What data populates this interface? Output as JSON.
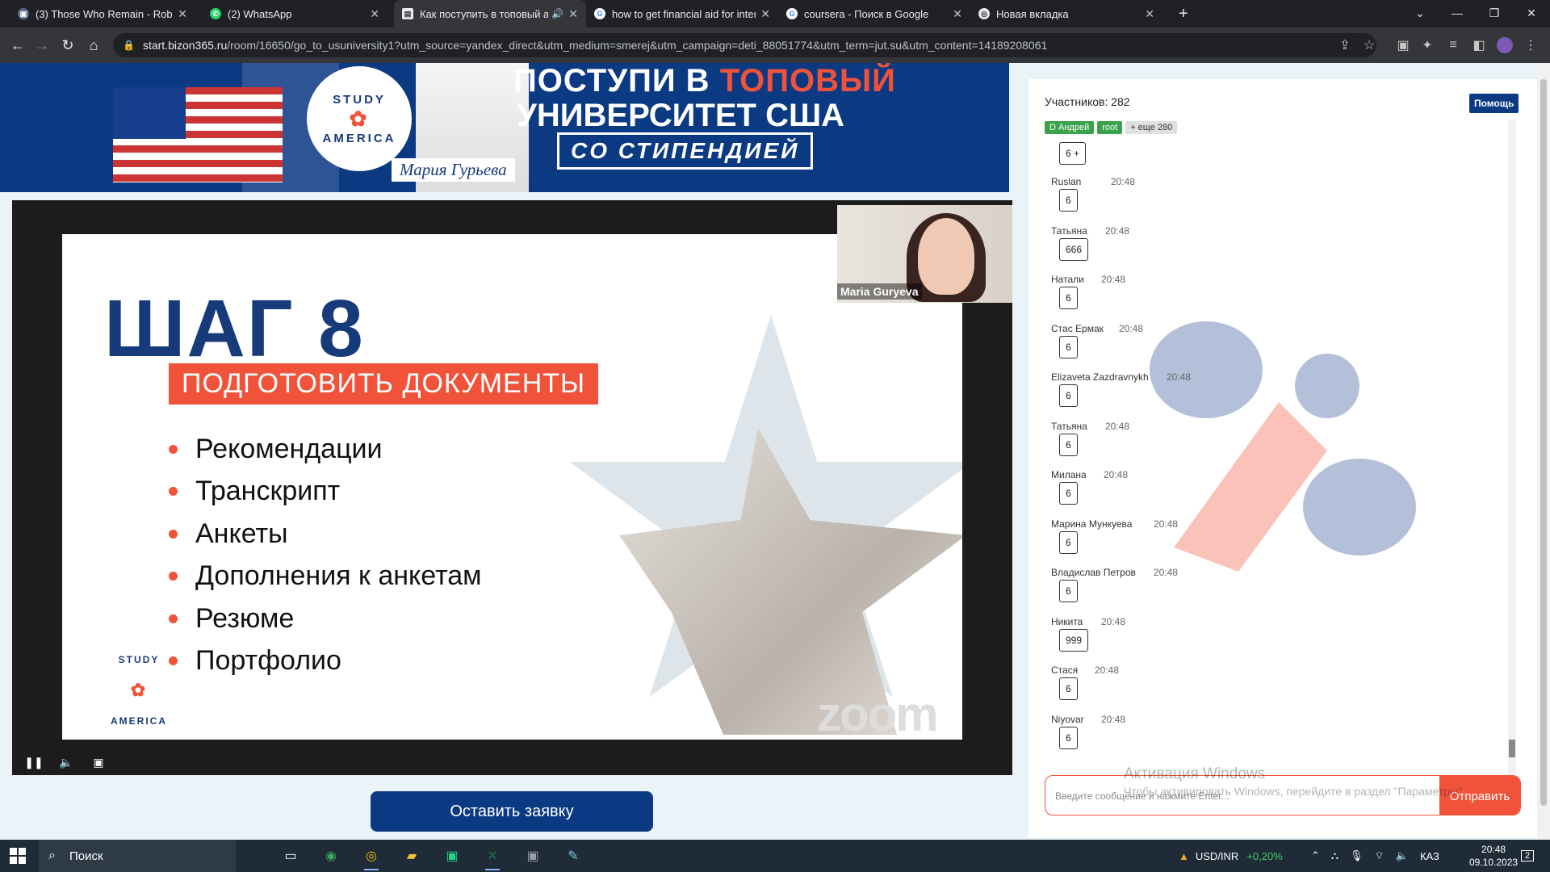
{
  "browser": {
    "tabs": [
      {
        "title": "(3) Those Who Remain - Roblox",
        "favicon": "roblox-icon",
        "active": false
      },
      {
        "title": "(2) WhatsApp",
        "favicon": "whatsapp-icon",
        "active": false
      },
      {
        "title": "Как поступить в топовый а",
        "favicon": "page-icon",
        "active": true
      },
      {
        "title": "how to get financial aid for inter",
        "favicon": "google-icon",
        "active": false
      },
      {
        "title": "coursera - Поиск в Google",
        "favicon": "google-icon",
        "active": false
      },
      {
        "title": "Новая вкладка",
        "favicon": "chrome-icon",
        "active": false
      }
    ],
    "url_host": "start.bizon365.ru",
    "url_path": "/room/16650/go_to_usuniversity1?utm_source=yandex_direct&utm_medium=smerej&utm_campaign=deti_88051774&utm_term=jut.su&utm_content=14189208061"
  },
  "banner": {
    "line1_a": "ПОСТУПИ В",
    "line1_b": "ТОПОВЫЙ",
    "line2": "УНИВЕРСИТЕТ США",
    "line3": "СО СТИПЕНДИЕЙ",
    "logo_top": "STUDY",
    "logo_bottom": "AMERICA",
    "host_name": "Мария Гурьева"
  },
  "slide": {
    "step": "ШАГ 8",
    "subtitle": "ПОДГОТОВИТЬ ДОКУМЕНТЫ",
    "items": [
      "Рекомендации",
      "Транскрипт",
      "Анкеты",
      "Дополнения к анкетам",
      "Резюме",
      "Портфолио"
    ],
    "logo_top": "STUDY",
    "logo_bottom": "AMERICA",
    "watermark": "zoom"
  },
  "camera": {
    "name": "Maria Guryeva"
  },
  "apply_button": "Оставить заявку",
  "chat": {
    "participants": "Участников: 282",
    "help": "Помощь",
    "tags": [
      {
        "label": "D Андрей",
        "color": "#3aa24a"
      },
      {
        "label": "root",
        "color": "#3aa24a"
      },
      {
        "label": "+ еще 280",
        "color": "#e0e0e0"
      }
    ],
    "first_value": "6 +",
    "messages": [
      {
        "author": "Ruslan",
        "time": "20:48",
        "text": "6"
      },
      {
        "author": "Татьяна",
        "time": "20:48",
        "text": "666"
      },
      {
        "author": "Натали",
        "time": "20:48",
        "text": "6"
      },
      {
        "author": "Стас Ермак",
        "time": "20:48",
        "text": "6"
      },
      {
        "author": "Elizaveta Zazdravnykh",
        "time": "20:48",
        "text": "6"
      },
      {
        "author": "Татьяна",
        "time": "20:48",
        "text": "6"
      },
      {
        "author": "Милана",
        "time": "20:48",
        "text": "6"
      },
      {
        "author": "Марина Мункуева",
        "time": "20:48",
        "text": "6"
      },
      {
        "author": "Владислав Петров",
        "time": "20:48",
        "text": "6"
      },
      {
        "author": "Никита",
        "time": "20:48",
        "text": "999"
      },
      {
        "author": "Стася",
        "time": "20:48",
        "text": "6"
      },
      {
        "author": "Niyovar",
        "time": "20:48",
        "text": "6"
      }
    ],
    "input_placeholder": "Введите сообщение и нажмите Enter...",
    "send": "Отправить"
  },
  "windows_activation": {
    "title": "Активация Windows",
    "text": "Чтобы активировать Windows, перейдите в раздел \"Параметры\"."
  },
  "taskbar": {
    "search": "Поиск",
    "ticker": "USD/INR",
    "ticker_change": "+0,20%",
    "lang": "КАЗ",
    "time": "20:48",
    "date": "09.10.2023",
    "notifications": "2"
  }
}
